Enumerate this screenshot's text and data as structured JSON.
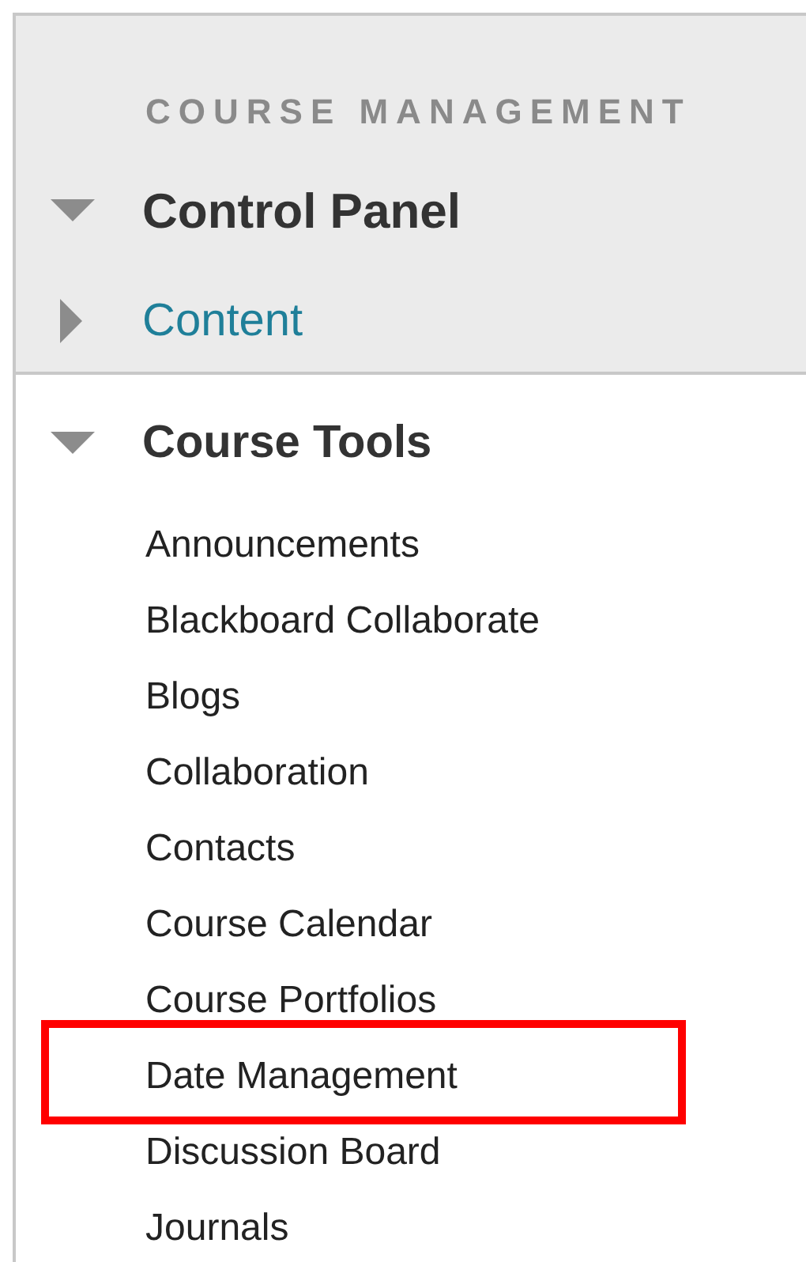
{
  "heading": "COURSE MANAGEMENT",
  "sections": [
    {
      "label": "Control Panel",
      "expanded": true,
      "kind": "header"
    },
    {
      "label": "Content",
      "expanded": false,
      "kind": "link"
    }
  ],
  "tools": {
    "label": "Course Tools",
    "expanded": true,
    "items": [
      {
        "label": "Announcements",
        "highlighted": false
      },
      {
        "label": "Blackboard Collaborate",
        "highlighted": false
      },
      {
        "label": "Blogs",
        "highlighted": false
      },
      {
        "label": "Collaboration",
        "highlighted": false
      },
      {
        "label": "Contacts",
        "highlighted": false
      },
      {
        "label": "Course Calendar",
        "highlighted": false
      },
      {
        "label": "Course Portfolios",
        "highlighted": false
      },
      {
        "label": "Date Management",
        "highlighted": true
      },
      {
        "label": "Discussion Board",
        "highlighted": false
      },
      {
        "label": "Journals",
        "highlighted": false
      }
    ]
  }
}
